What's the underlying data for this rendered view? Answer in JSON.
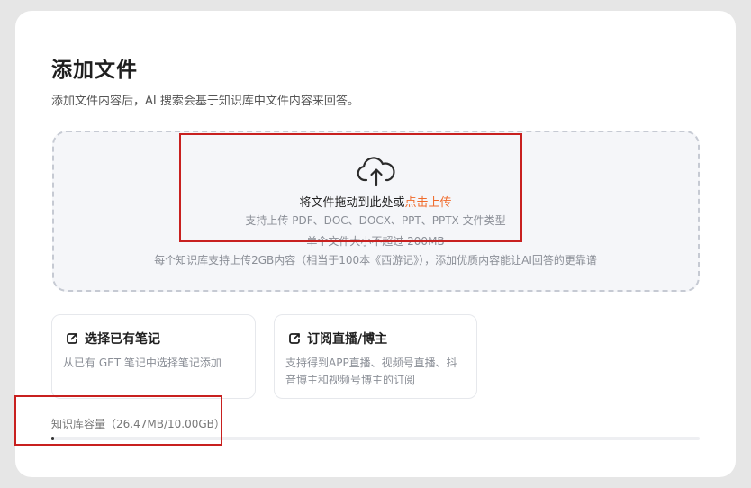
{
  "page": {
    "title": "添加文件",
    "subtitle": "添加文件内容后，AI 搜索会基于知识库中文件内容来回答。"
  },
  "upload": {
    "icon": "cloud-upload-icon",
    "main_prefix": "将文件拖动到此处或",
    "main_link": "点击上传",
    "types": "支持上传 PDF、DOC、DOCX、PPT、PPTX 文件类型",
    "size_limit": "单个文件大小不超过 200MB",
    "note": "每个知识库支持上传2GB内容（相当于100本《西游记》），添加优质内容能让AI回答的更靠谱"
  },
  "options": [
    {
      "title": "选择已有笔记",
      "desc": "从已有 GET 笔记中选择笔记添加",
      "icon": "note-link-icon"
    },
    {
      "title": "订阅直播/博主",
      "desc": "支持得到APP直播、视频号直播、抖音博主和视频号博主的订阅",
      "icon": "subscribe-link-icon"
    }
  ],
  "capacity": {
    "label": "知识库容量（26.47MB/10.00GB）",
    "fraction": 0.0026
  },
  "colors": {
    "accent": "#f06a2a",
    "highlight": "#c8201f",
    "progress": "#333333"
  }
}
